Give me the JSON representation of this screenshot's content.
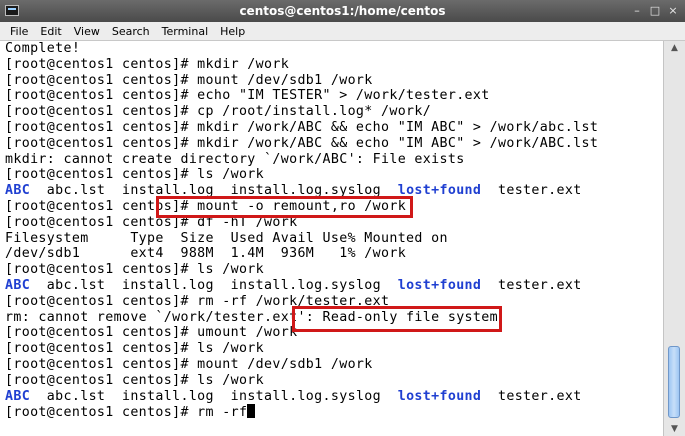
{
  "window": {
    "title": "centos@centos1:/home/centos",
    "controls": [
      "–",
      "□",
      "×"
    ]
  },
  "menu": [
    "File",
    "Edit",
    "View",
    "Search",
    "Terminal",
    "Help"
  ],
  "terminal": {
    "lines": [
      [
        {
          "t": "Complete!"
        }
      ],
      [
        {
          "t": "[root@centos1 centos]# mkdir /work"
        }
      ],
      [
        {
          "t": "[root@centos1 centos]# mount /dev/sdb1 /work"
        }
      ],
      [
        {
          "t": "[root@centos1 centos]# echo \"IM TESTER\" > /work/tester.ext"
        }
      ],
      [
        {
          "t": "[root@centos1 centos]# cp /root/install.log* /work/"
        }
      ],
      [
        {
          "t": "[root@centos1 centos]# mkdir /work/ABC && echo \"IM ABC\" > /work/abc.lst"
        }
      ],
      [
        {
          "t": "[root@centos1 centos]# mkdir /work/ABC && echo \"IM ABC\" > /work/ABC.lst"
        }
      ],
      [
        {
          "t": "mkdir: cannot create directory `/work/ABC': File exists"
        }
      ],
      [
        {
          "t": "[root@centos1 centos]# ls /work"
        }
      ],
      [
        {
          "t": "ABC",
          "c": "dir"
        },
        {
          "t": "  abc.lst  install.log  install.log.syslog  "
        },
        {
          "t": "lost+found",
          "c": "dir"
        },
        {
          "t": "  tester.ext"
        }
      ],
      [
        {
          "t": "[root@centos1 centos]# mount -o remount,ro /work"
        }
      ],
      [
        {
          "t": "[root@centos1 centos]# df -hT /work"
        }
      ],
      [
        {
          "t": "Filesystem     Type  Size  Used Avail Use% Mounted on"
        }
      ],
      [
        {
          "t": "/dev/sdb1      ext4  988M  1.4M  936M   1% /work"
        }
      ],
      [
        {
          "t": "[root@centos1 centos]# ls /work"
        }
      ],
      [
        {
          "t": "ABC",
          "c": "dir"
        },
        {
          "t": "  abc.lst  install.log  install.log.syslog  "
        },
        {
          "t": "lost+found",
          "c": "dir"
        },
        {
          "t": "  tester.ext"
        }
      ],
      [
        {
          "t": "[root@centos1 centos]# rm -rf /work/tester.ext"
        }
      ],
      [
        {
          "t": "rm: cannot remove `/work/tester.ext': Read-only file system"
        }
      ],
      [
        {
          "t": "[root@centos1 centos]# umount /work"
        }
      ],
      [
        {
          "t": "[root@centos1 centos]# ls /work"
        }
      ],
      [
        {
          "t": "[root@centos1 centos]# mount /dev/sdb1 /work"
        }
      ],
      [
        {
          "t": "[root@centos1 centos]# ls /work"
        }
      ],
      [
        {
          "t": "ABC",
          "c": "dir"
        },
        {
          "t": "  abc.lst  install.log  install.log.syslog  "
        },
        {
          "t": "lost+found",
          "c": "dir"
        },
        {
          "t": "  tester.ext"
        }
      ],
      [
        {
          "t": "[root@centos1 centos]# rm -rf"
        },
        {
          "cursor": true
        }
      ]
    ]
  },
  "colors": {
    "directory": "#1f3fd1",
    "highlight": "#d01818",
    "scroll_thumb": "#9ec6f3"
  }
}
